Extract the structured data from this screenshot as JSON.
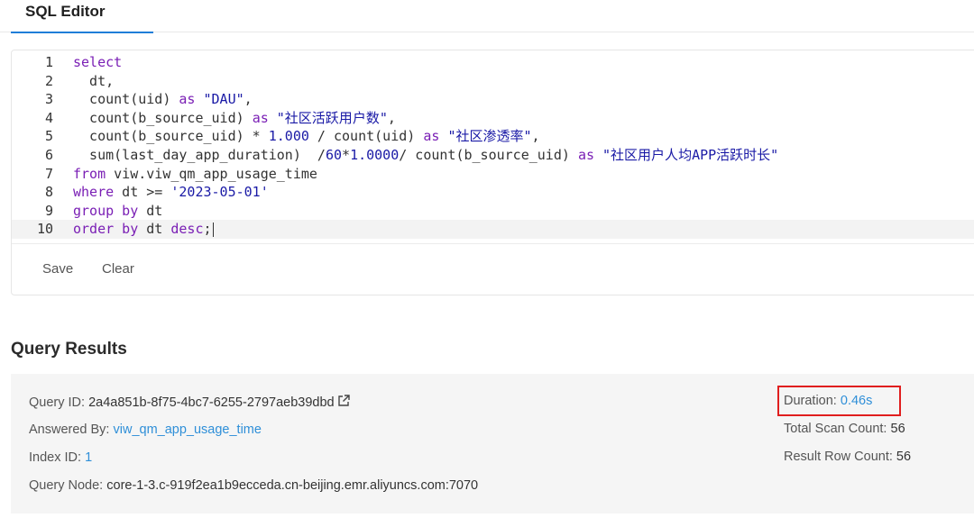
{
  "tab": {
    "label": "SQL Editor"
  },
  "editor": {
    "lines": [
      {
        "n": "1",
        "tokens": [
          [
            "kw",
            "select"
          ]
        ]
      },
      {
        "n": "2",
        "tokens": [
          [
            "t",
            "  dt,"
          ]
        ]
      },
      {
        "n": "3",
        "tokens": [
          [
            "t",
            "  count(uid) "
          ],
          [
            "kw",
            "as"
          ],
          [
            "t",
            " "
          ],
          [
            "str",
            "\"DAU\""
          ],
          [
            "t",
            ","
          ]
        ]
      },
      {
        "n": "4",
        "tokens": [
          [
            "t",
            "  count(b_source_uid) "
          ],
          [
            "kw",
            "as"
          ],
          [
            "t",
            " "
          ],
          [
            "str",
            "\"社区活跃用户数\""
          ],
          [
            "t",
            ","
          ]
        ]
      },
      {
        "n": "5",
        "tokens": [
          [
            "t",
            "  count(b_source_uid) * "
          ],
          [
            "num",
            "1.000"
          ],
          [
            "t",
            " / count(uid) "
          ],
          [
            "kw",
            "as"
          ],
          [
            "t",
            " "
          ],
          [
            "str",
            "\"社区渗透率\""
          ],
          [
            "t",
            ","
          ]
        ]
      },
      {
        "n": "6",
        "tokens": [
          [
            "t",
            "  sum(last_day_app_duration)  /"
          ],
          [
            "num",
            "60"
          ],
          [
            "t",
            "*"
          ],
          [
            "num",
            "1.0000"
          ],
          [
            "t",
            "/ count(b_source_uid) "
          ],
          [
            "kw",
            "as"
          ],
          [
            "t",
            " "
          ],
          [
            "str",
            "\"社区用户人均APP活跃时长\""
          ]
        ]
      },
      {
        "n": "7",
        "tokens": [
          [
            "kw",
            "from"
          ],
          [
            "t",
            " viw.viw_qm_app_usage_time"
          ]
        ]
      },
      {
        "n": "8",
        "tokens": [
          [
            "kw",
            "where"
          ],
          [
            "t",
            " dt >= "
          ],
          [
            "str",
            "'2023-05-01'"
          ]
        ]
      },
      {
        "n": "9",
        "tokens": [
          [
            "kw",
            "group by"
          ],
          [
            "t",
            " dt"
          ]
        ]
      },
      {
        "n": "10",
        "tokens": [
          [
            "kw",
            "order by"
          ],
          [
            "t",
            " dt "
          ],
          [
            "kw",
            "desc"
          ],
          [
            "t",
            ";"
          ]
        ]
      }
    ]
  },
  "actions": {
    "save_label": "Save",
    "clear_label": "Clear"
  },
  "results": {
    "title": "Query Results",
    "query_id_label": "Query ID:",
    "query_id_value": "2a4a851b-8f75-4bc7-6255-2797aeb39dbd",
    "answered_by_label": "Answered By:",
    "answered_by_value": "viw_qm_app_usage_time",
    "index_id_label": "Index ID:",
    "index_id_value": "1",
    "query_node_label": "Query Node:",
    "query_node_value": "core-1-3.c-919f2ea1b9ecceda.cn-beijing.emr.aliyuncs.com:7070",
    "duration_label": "Duration:",
    "duration_value": "0.46s",
    "total_scan_label": "Total Scan Count:",
    "total_scan_value": "56",
    "result_row_label": "Result Row Count:",
    "result_row_value": "56"
  },
  "colors": {
    "accent": "#1f7ed8",
    "link": "#2f8fd8",
    "highlight": "#e01e1e",
    "keyword": "#7a1fb5",
    "string": "#1a1aa6"
  },
  "icons": {
    "external_link": "external-link-icon"
  }
}
